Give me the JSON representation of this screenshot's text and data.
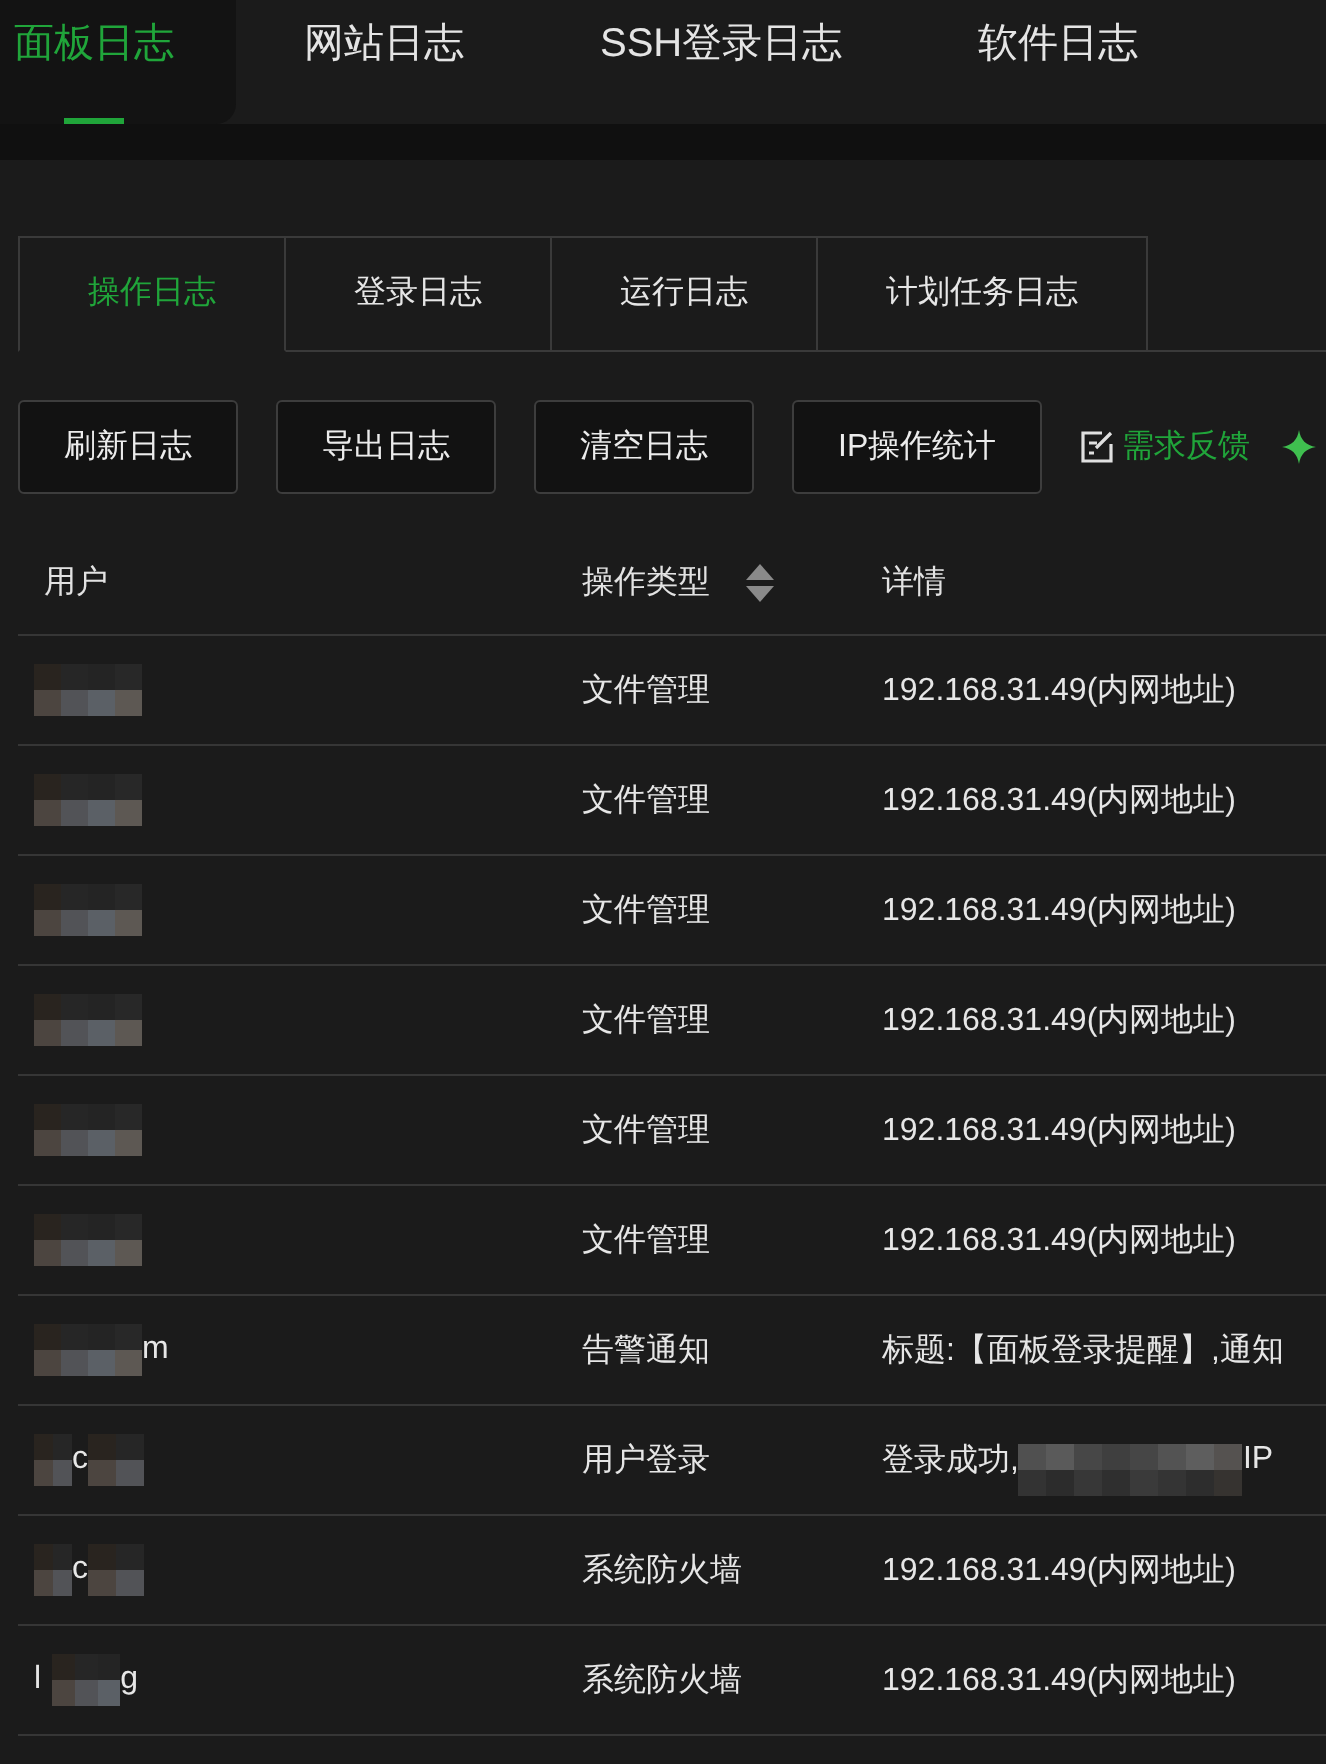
{
  "top_tabs": [
    {
      "label": "面板日志",
      "selected": true
    },
    {
      "label": "网站日志",
      "selected": false
    },
    {
      "label": "SSH登录日志",
      "selected": false
    },
    {
      "label": "软件日志",
      "selected": false
    }
  ],
  "sub_tabs": [
    {
      "label": "操作日志",
      "selected": true
    },
    {
      "label": "登录日志",
      "selected": false
    },
    {
      "label": "运行日志",
      "selected": false
    },
    {
      "label": "计划任务日志",
      "selected": false
    }
  ],
  "toolbar": {
    "buttons": [
      "刷新日志",
      "导出日志",
      "清空日志",
      "IP操作统计"
    ],
    "feedback_link": "需求反馈"
  },
  "table": {
    "columns": [
      {
        "label": "用户",
        "sortable": false
      },
      {
        "label": "操作类型",
        "sortable": true
      },
      {
        "label": "详情",
        "sortable": false
      }
    ],
    "rows": [
      {
        "user": [
          {
            "kind": "redacted"
          }
        ],
        "type": "文件管理",
        "details": [
          {
            "kind": "text",
            "text": "192.168.31.49(内网地址)"
          }
        ]
      },
      {
        "user": [
          {
            "kind": "redacted"
          }
        ],
        "type": "文件管理",
        "details": [
          {
            "kind": "text",
            "text": "192.168.31.49(内网地址)"
          }
        ]
      },
      {
        "user": [
          {
            "kind": "redacted"
          }
        ],
        "type": "文件管理",
        "details": [
          {
            "kind": "text",
            "text": "192.168.31.49(内网地址)"
          }
        ]
      },
      {
        "user": [
          {
            "kind": "redacted"
          }
        ],
        "type": "文件管理",
        "details": [
          {
            "kind": "text",
            "text": "192.168.31.49(内网地址)"
          }
        ]
      },
      {
        "user": [
          {
            "kind": "redacted"
          }
        ],
        "type": "文件管理",
        "details": [
          {
            "kind": "text",
            "text": "192.168.31.49(内网地址)"
          }
        ]
      },
      {
        "user": [
          {
            "kind": "redacted"
          }
        ],
        "type": "文件管理",
        "details": [
          {
            "kind": "text",
            "text": "192.168.31.49(内网地址)"
          }
        ]
      },
      {
        "user": [
          {
            "kind": "redacted"
          },
          {
            "kind": "text",
            "text": "m"
          }
        ],
        "type": "告警通知",
        "details": [
          {
            "kind": "text",
            "text": "标题:【面板登录提醒】,通知"
          }
        ]
      },
      {
        "user": [
          {
            "kind": "redacted"
          },
          {
            "kind": "text",
            "text": "c"
          },
          {
            "kind": "redacted"
          }
        ],
        "type": "用户登录",
        "details": [
          {
            "kind": "text",
            "text": "登录成功,"
          },
          {
            "kind": "redacted"
          },
          {
            "kind": "text",
            "text": "IP"
          }
        ]
      },
      {
        "user": [
          {
            "kind": "redacted"
          },
          {
            "kind": "text",
            "text": "c"
          },
          {
            "kind": "redacted"
          }
        ],
        "type": "系统防火墙",
        "details": [
          {
            "kind": "text",
            "text": "192.168.31.49(内网地址)"
          }
        ]
      },
      {
        "user": [
          {
            "kind": "text",
            "text": "l"
          },
          {
            "kind": "redacted"
          },
          {
            "kind": "text",
            "text": "g"
          }
        ],
        "type": "系统防火墙",
        "details": [
          {
            "kind": "text",
            "text": "192.168.31.49(内网地址)"
          }
        ]
      }
    ]
  }
}
